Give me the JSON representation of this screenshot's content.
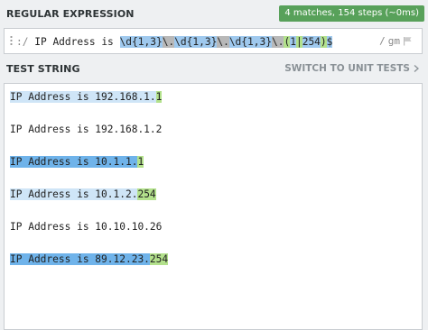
{
  "regex_section": {
    "title": "REGULAR EXPRESSION",
    "match_info": "4 matches, 154 steps (~0ms)",
    "open_delimiter": ":/",
    "literal": "IP Address is ",
    "tokens": [
      "\\d{1,3}",
      "\\.",
      "\\d{1,3}",
      "\\.",
      "\\d{1,3}",
      "\\.",
      "(",
      "1",
      "|",
      "254",
      ")",
      "$"
    ],
    "close_delimiter": "/",
    "flags": "gm",
    "flag_icon": "flag-icon"
  },
  "test_section": {
    "title": "TEST STRING",
    "switch_label": "SWITCH TO UNIT TESTS",
    "switch_icon": "chevron-right-icon",
    "lines": [
      {
        "prefix": "IP Address is 192.168.1.",
        "suffix": "1"
      },
      {
        "text": "IP Address is 192.168.1.2"
      },
      {
        "prefix": "IP Address is 10.1.1.",
        "suffix": "1"
      },
      {
        "prefix": "IP Address is 10.1.2.",
        "suffix": "254"
      },
      {
        "text": "IP Address is 10.10.10.26"
      },
      {
        "prefix": "IP Address is 89.12.23.",
        "suffix": "254"
      }
    ]
  }
}
